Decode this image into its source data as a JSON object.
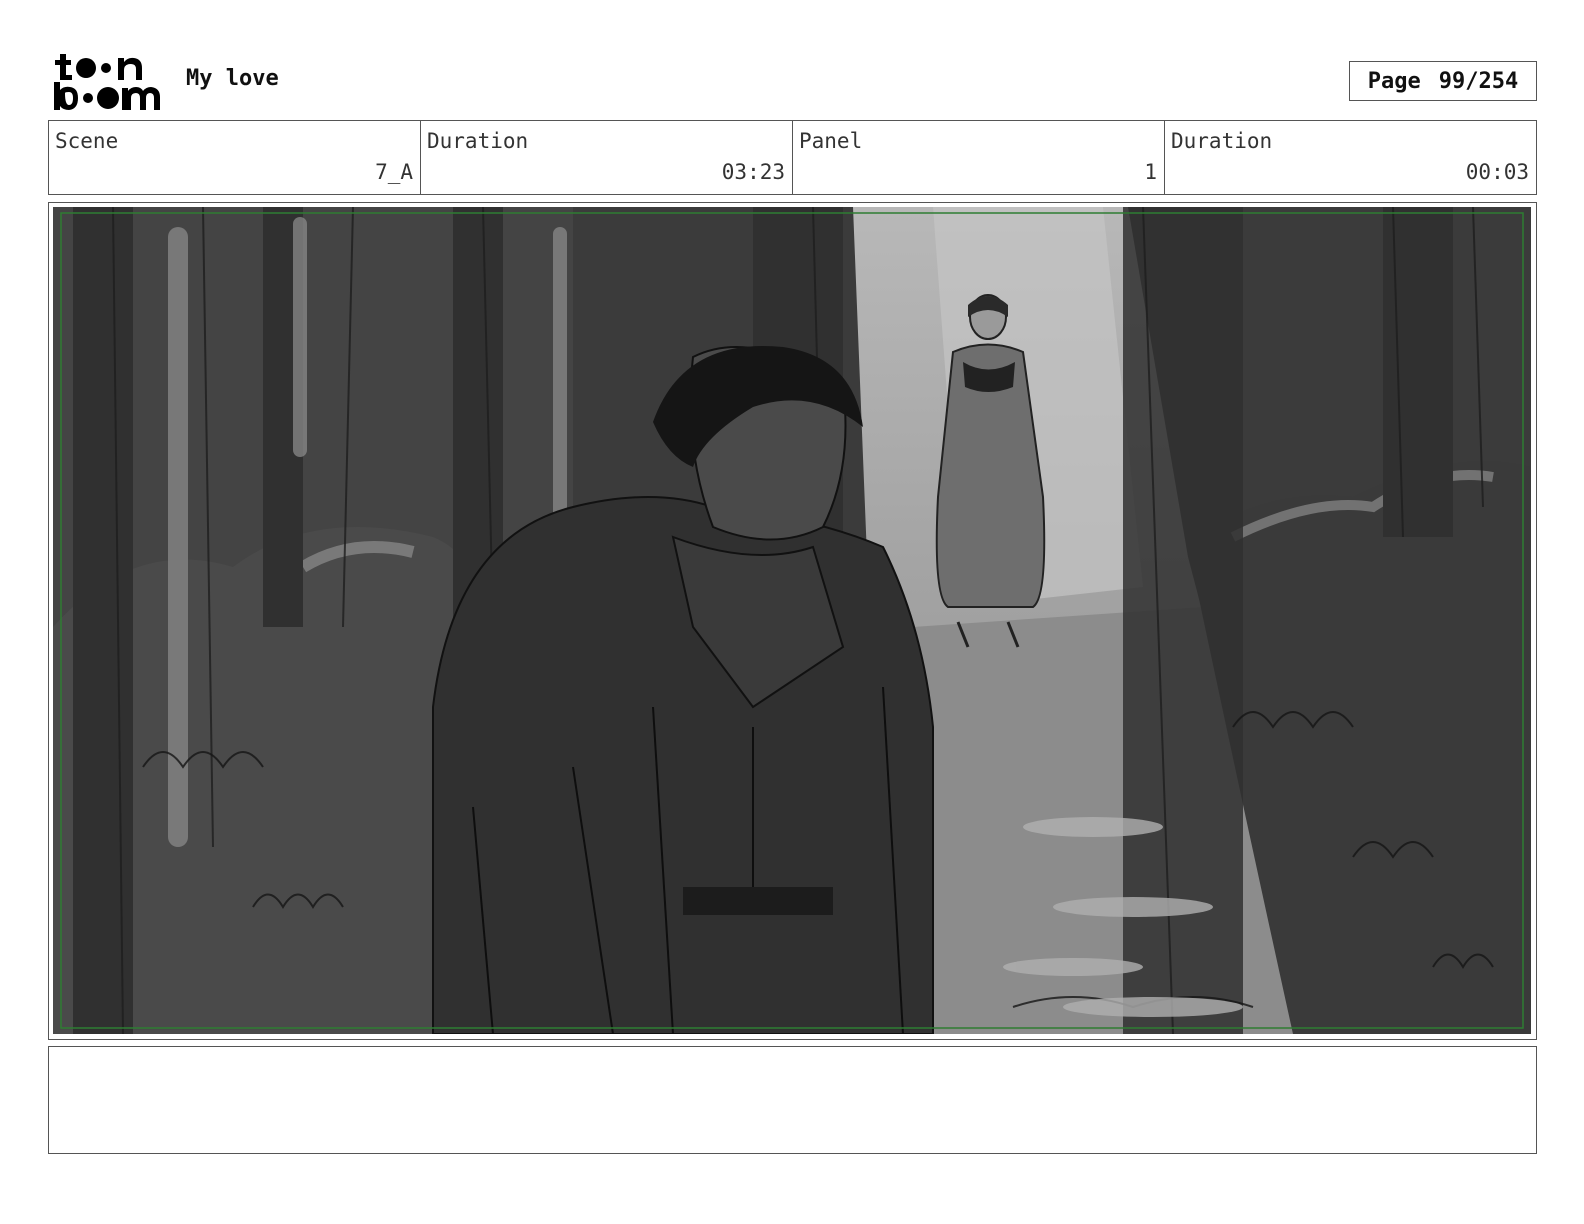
{
  "header": {
    "logo": {
      "line1": "toon",
      "line2": "boom"
    },
    "title": "My love",
    "page_label": "Page",
    "page_value": "99/254"
  },
  "info": {
    "scene_label": "Scene",
    "scene_value": "7_A",
    "duration_label": "Duration",
    "duration_value": "03:23",
    "panel_label": "Panel",
    "panel_value": "1",
    "panel_duration_label": "Duration",
    "panel_duration_value": "00:03"
  },
  "colors": {
    "border": "#555555",
    "safe_area": "#2e7d32",
    "sketch_dark": "#2f2f2f",
    "sketch_light": "#9a9a9a"
  },
  "notes": {
    "text": ""
  }
}
